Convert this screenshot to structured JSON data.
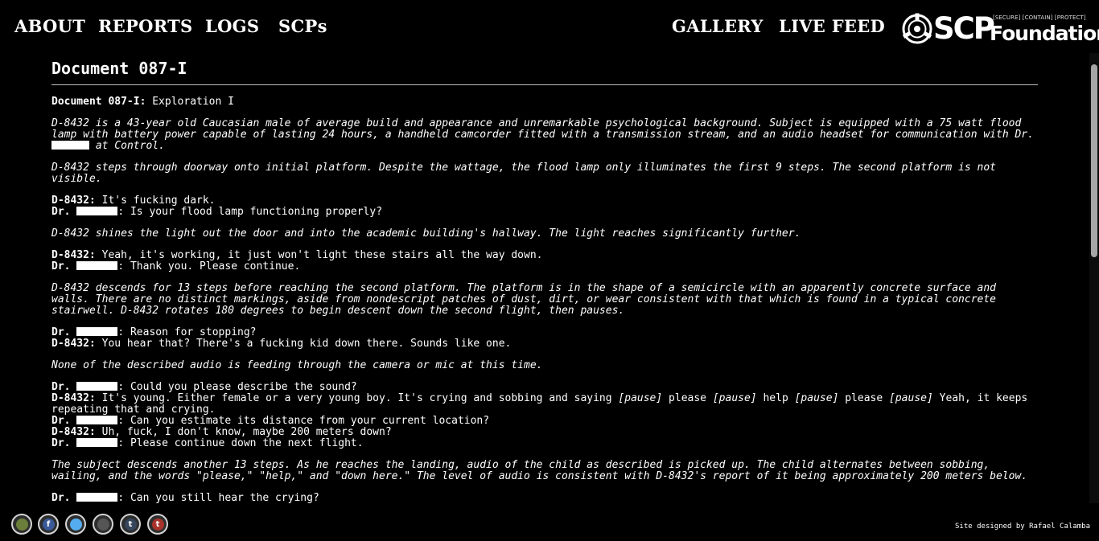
{
  "nav": {
    "about": "ABOUT",
    "reports": "REPORTS",
    "logs": "LOGS",
    "scps": "SCPs",
    "gallery": "GALLERY",
    "live_feed": "LIVE FEED"
  },
  "logo": {
    "icon": "scp-seal-icon",
    "wordmark": "SCP",
    "tagline": "[SECURE] [CONTAIN] [PROTECT]",
    "sub": "Foundation"
  },
  "document": {
    "title": "Document 087-I",
    "header_label": "Document 087-I:",
    "header_value": " Exploration I",
    "p1": "D-8432 is a 43-year old Caucasian male of average build and appearance and unremarkable psychological background. Subject is equipped with a 75 watt flood lamp with battery power capable of lasting 24 hours, a handheld camcorder fitted with a transmission stream, and an audio headset for communication with Dr.",
    "p1_tail": " at Control.",
    "p2": "D-8432 steps through doorway onto initial platform. Despite the wattage, the flood lamp only illuminates the first 9 steps. The second platform is not visible.",
    "d1": {
      "speaker": "D-8432:",
      "text": " It's fucking dark."
    },
    "d2": {
      "speaker": "Dr.",
      "text": ": Is your flood lamp functioning properly?"
    },
    "p3": "D-8432 shines the light out the door and into the academic building's hallway. The light reaches significantly further.",
    "d3": {
      "speaker": "D-8432:",
      "text": " Yeah, it's working, it just won't light these stairs all the way down."
    },
    "d4": {
      "speaker": "Dr.",
      "text": ": Thank you. Please continue."
    },
    "p4": "D-8432 descends for 13 steps before reaching the second platform. The platform is in the shape of a semicircle with an apparently concrete surface and walls. There are no distinct markings, aside from nondescript patches of dust, dirt, or wear consistent with that which is found in a typical concrete stairwell. D-8432 rotates 180 degrees to begin descent down the second flight, then pauses.",
    "d5": {
      "speaker": "Dr.",
      "text": ": Reason for stopping?"
    },
    "d6": {
      "speaker": "D-8432:",
      "text": " You hear that? There's a fucking kid down there. Sounds like one."
    },
    "p5": "None of the described audio is feeding through the camera or mic at this time.",
    "d7": {
      "speaker": "Dr.",
      "text": ": Could you please describe the sound?"
    },
    "d8": {
      "speaker": "D-8432:",
      "a": " It's young. Either female or a very young boy. It's crying and sobbing and saying ",
      "pause": "[pause]",
      "please": " please ",
      "help": " help ",
      "please2": " please ",
      "tail": " Yeah, it keeps repeating that and crying."
    },
    "d9": {
      "speaker": "Dr.",
      "text": ": Can you estimate its distance from your current location?"
    },
    "d10": {
      "speaker": "D-8432:",
      "text": " Uh, fuck, I don't know, maybe 200 meters down?"
    },
    "d11": {
      "speaker": "Dr.",
      "text": ": Please continue down the next flight."
    },
    "p6": "The subject descends another 13 steps. As he reaches the landing, audio of the child as described is picked up. The child alternates between sobbing, wailing, and the words \"please,\" \"help,\" and \"down here.\" The level of audio is consistent with D-8432's report of it being approximately 200 meters below.",
    "d12": {
      "speaker": "Dr.",
      "text": ": Can you still hear the crying?"
    }
  },
  "footer": {
    "social_icons": [
      "scp-wiki-icon",
      "facebook-icon",
      "twitter-icon",
      "scp-seal-icon",
      "tumblr-icon",
      "tumblr-red-icon"
    ],
    "social_colors": [
      "#6b7f3a",
      "#3b5998",
      "#55acee",
      "#555555",
      "#35465c",
      "#a8332a"
    ],
    "social_glyphs": [
      "",
      "f",
      "",
      "",
      "t",
      "t"
    ],
    "credit": "Site designed by Rafael Calamba"
  }
}
